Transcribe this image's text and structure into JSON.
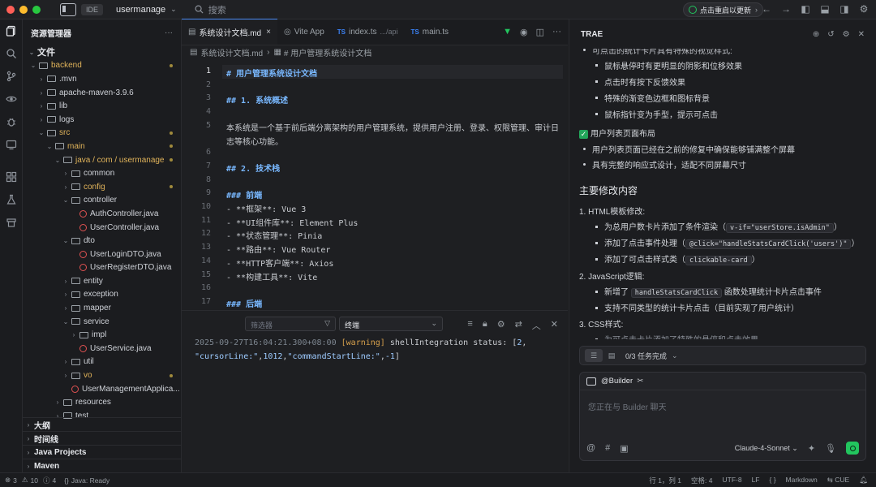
{
  "titlebar": {
    "ide_badge": "IDE",
    "project": "usermanage",
    "search_placeholder": "搜索",
    "restart_label": "点击重启以更新"
  },
  "sidebar": {
    "title": "资源管理器",
    "root": "文件",
    "tree": [
      {
        "label": "backend",
        "depth": 0,
        "type": "folder",
        "open": true,
        "color": "orange",
        "dot": true
      },
      {
        "label": ".mvn",
        "depth": 1,
        "type": "folder"
      },
      {
        "label": "apache-maven-3.9.6",
        "depth": 1,
        "type": "folder"
      },
      {
        "label": "lib",
        "depth": 1,
        "type": "folder"
      },
      {
        "label": "logs",
        "depth": 1,
        "type": "folder"
      },
      {
        "label": "src",
        "depth": 1,
        "type": "folder",
        "open": true,
        "color": "orange",
        "dot": true
      },
      {
        "label": "main",
        "depth": 2,
        "type": "folder",
        "open": true,
        "color": "orange",
        "dot": true
      },
      {
        "label": "java / com / usermanage",
        "depth": 3,
        "type": "folder",
        "open": true,
        "color": "orange",
        "dot": true
      },
      {
        "label": "common",
        "depth": 4,
        "type": "folder"
      },
      {
        "label": "config",
        "depth": 4,
        "type": "folder",
        "color": "orange",
        "dot": true
      },
      {
        "label": "controller",
        "depth": 4,
        "type": "folder",
        "open": true
      },
      {
        "label": "AuthController.java",
        "depth": 5,
        "type": "java"
      },
      {
        "label": "UserController.java",
        "depth": 5,
        "type": "java"
      },
      {
        "label": "dto",
        "depth": 4,
        "type": "folder",
        "open": true
      },
      {
        "label": "UserLoginDTO.java",
        "depth": 5,
        "type": "java"
      },
      {
        "label": "UserRegisterDTO.java",
        "depth": 5,
        "type": "java"
      },
      {
        "label": "entity",
        "depth": 4,
        "type": "folder"
      },
      {
        "label": "exception",
        "depth": 4,
        "type": "folder"
      },
      {
        "label": "mapper",
        "depth": 4,
        "type": "folder"
      },
      {
        "label": "service",
        "depth": 4,
        "type": "folder",
        "open": true
      },
      {
        "label": "impl",
        "depth": 5,
        "type": "folder"
      },
      {
        "label": "UserService.java",
        "depth": 5,
        "type": "java"
      },
      {
        "label": "util",
        "depth": 4,
        "type": "folder"
      },
      {
        "label": "vo",
        "depth": 4,
        "type": "folder",
        "color": "orange",
        "dot": true
      },
      {
        "label": "UserManagementApplica...",
        "depth": 4,
        "type": "java"
      },
      {
        "label": "resources",
        "depth": 3,
        "type": "folder"
      },
      {
        "label": "test",
        "depth": 3,
        "type": "folder"
      }
    ],
    "sections": [
      "大纲",
      "时间线",
      "Java Projects",
      "Maven"
    ]
  },
  "editor": {
    "tabs": [
      {
        "icon": "doc",
        "label": "系统设计文档.md",
        "active": true,
        "close": "×"
      },
      {
        "icon": "vite",
        "label": "Vite App"
      },
      {
        "icon": "TS",
        "label": "index.ts",
        "sub": ".../api"
      },
      {
        "icon": "TS",
        "label": "main.ts"
      }
    ],
    "breadcrumb": [
      "系统设计文档.md",
      "# 用户管理系统设计文档"
    ],
    "lines": [
      {
        "n": "1",
        "t": "# 用户管理系统设计文档",
        "h": true,
        "cur": true
      },
      {
        "n": "2",
        "t": ""
      },
      {
        "n": "3",
        "t": "## 1. 系统概述",
        "h": true
      },
      {
        "n": "4",
        "t": ""
      },
      {
        "n": "5",
        "t": "本系统是一个基于前后端分离架构的用户管理系统，提供用户注册、登录、权限管理、审计日"
      },
      {
        "n": "",
        "t": "志等核心功能。"
      },
      {
        "n": "6",
        "t": ""
      },
      {
        "n": "7",
        "t": "## 2. 技术栈",
        "h": true
      },
      {
        "n": "8",
        "t": ""
      },
      {
        "n": "9",
        "t": "### 前端",
        "h": true
      },
      {
        "n": "10",
        "t": "- **框架**: Vue 3"
      },
      {
        "n": "11",
        "t": "- **UI组件库**: Element Plus"
      },
      {
        "n": "12",
        "t": "- **状态管理**: Pinia"
      },
      {
        "n": "13",
        "t": "- **路由**: Vue Router"
      },
      {
        "n": "14",
        "t": "- **HTTP客户端**: Axios"
      },
      {
        "n": "15",
        "t": "- **构建工具**: Vite"
      },
      {
        "n": "16",
        "t": ""
      },
      {
        "n": "17",
        "t": "### 后端",
        "h": true
      }
    ]
  },
  "terminal": {
    "filter_placeholder": "筛选器",
    "selected": "终端",
    "timestamp": "2025-09-27T16:04:21.300+08:00",
    "level": "[warning]",
    "msg1": " shellIntegration status: [",
    "n2": "2",
    "comma1": ",",
    "s_cursor": "\"cursorLine:\"",
    "comma2": ",",
    "n1012": "1012",
    "comma3": ",",
    "s_start": "\"commandStartLine:\"",
    "comma4": ",",
    "n_neg": "-1",
    "close": "]"
  },
  "panel": {
    "title": "TRAE",
    "top_line": "可点击的统计卡片具有特殊的视觉样式:",
    "sub1": [
      "鼠标悬停时有更明显的阴影和位移效果",
      "点击时有按下反馈效果",
      "特殊的渐变色边框和图标背景",
      "鼠标指针变为手型，提示可点击"
    ],
    "done_title": "用户列表页面布局",
    "done_items": [
      "用户列表页面已经在之前的修复中确保能够铺满整个屏幕",
      "具有完整的响应式设计，适配不同屏幕尺寸"
    ],
    "heading": "主要修改内容",
    "s1": "1. HTML模板修改:",
    "s1a_pre": "为总用户数卡片添加了条件渲染（",
    "s1a_code": "v-if=\"userStore.isAdmin\"",
    "s1a_post": "）",
    "s1b_pre": "添加了点击事件处理（",
    "s1b_code": "@click=\"handleStatsCardClick('users')\"",
    "s1b_post": "）",
    "s1c_pre": "添加了可点击样式类（",
    "s1c_code": "clickable-card",
    "s1c_post": "）",
    "s2": "2. JavaScript逻辑:",
    "s2a_pre": "新增了",
    "s2a_code": "handleStatsCardClick",
    "s2a_post": "函数处理统计卡片点击事件",
    "s2b": "支持不同类型的统计卡片点击（目前实现了用户统计）",
    "s3": "3. CSS样式:",
    "s3a": "为可点击卡片添加了特殊的悬停和点击效果",
    "tasks": "0/3 任务完成",
    "builder": "@Builder",
    "placeholder": "您正在与 Builder 聊天",
    "model": "Claude-4-Sonnet"
  },
  "status": {
    "errors": "3",
    "warnings": "10",
    "info": "4",
    "java": "Java: Ready",
    "position": "行 1，列 1",
    "spaces": "空格: 4",
    "encoding": "UTF-8",
    "eol": "LF",
    "braces": "{ }",
    "lang": "Markdown",
    "cue": "CUE"
  },
  "colors": {
    "accent": "#4c8bf5",
    "green": "#22c55e",
    "folder_orange": "#e0b35a",
    "error": "#e05252"
  }
}
